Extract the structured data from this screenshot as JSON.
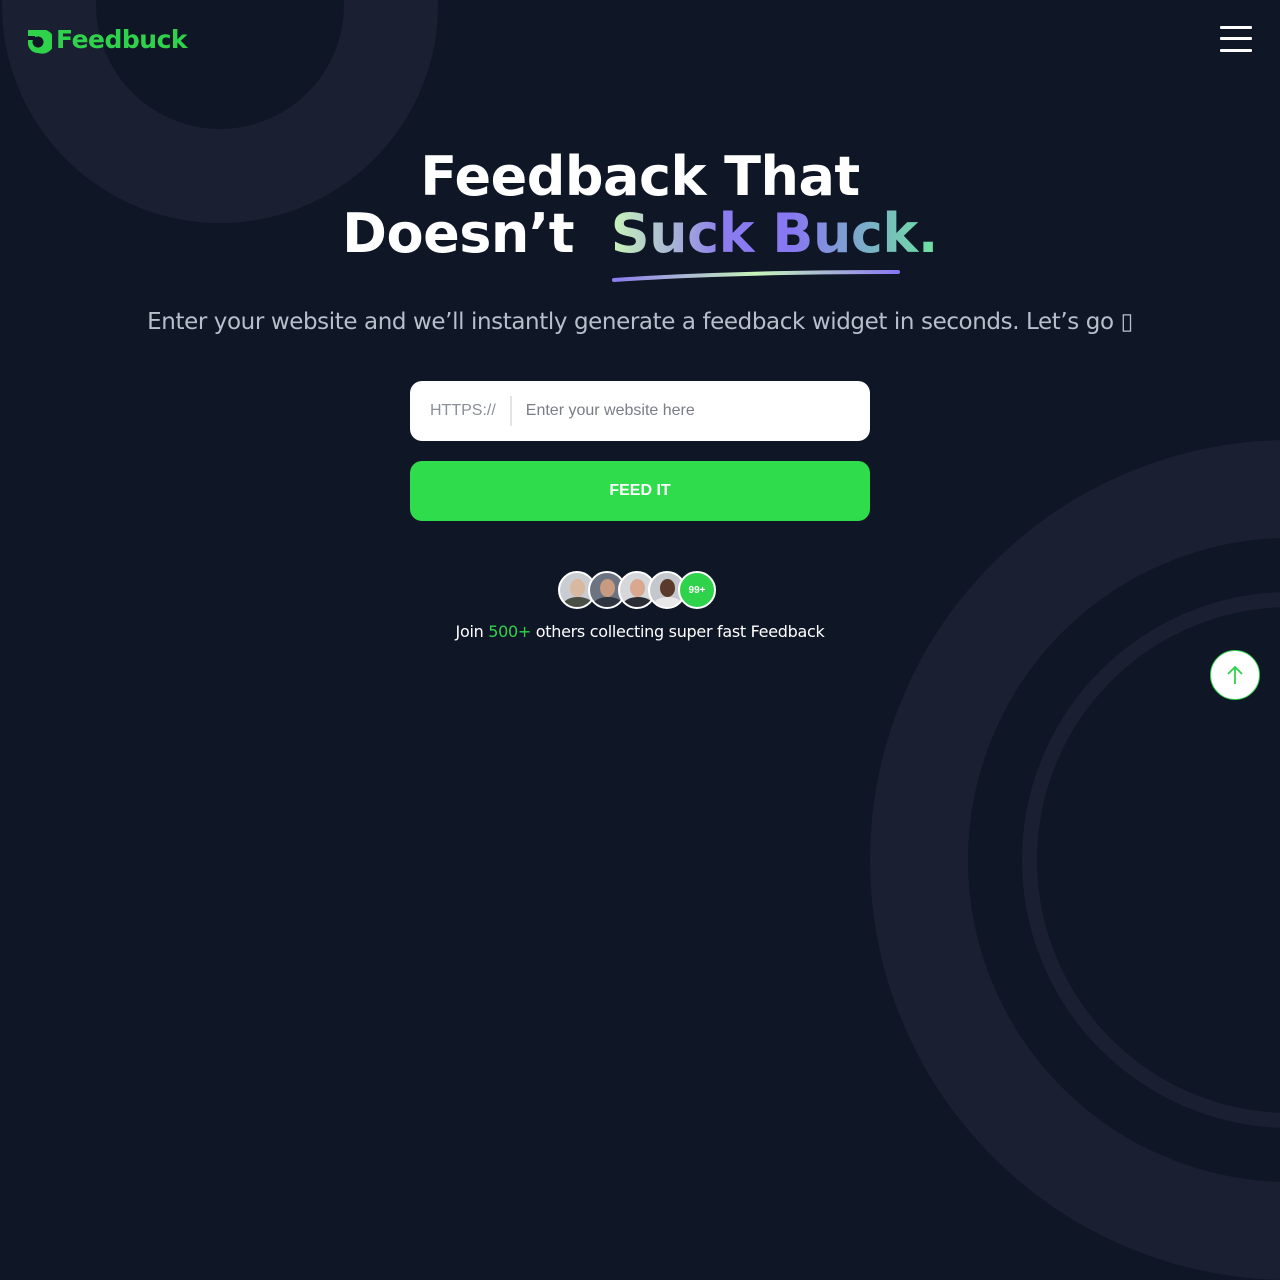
{
  "brand": {
    "name": "Feedbuck",
    "color": "#2fd34b"
  },
  "header": {
    "menu_icon": "hamburger-menu-icon"
  },
  "hero": {
    "title_line1": "Feedback That",
    "title_line2_plain": "Doesn’t",
    "title_line2_highlight": "Suck Buck.",
    "subtitle": "Enter your website and we’ll instantly generate a feedback widget in seconds. Let’s go ▯"
  },
  "form": {
    "prefix": "HTTPS://",
    "placeholder": "Enter your website here",
    "value": "",
    "submit_label": "FEED IT"
  },
  "social_proof": {
    "avatar_count_badge": "99+",
    "join_prefix": "Join",
    "join_count": "500+",
    "join_suffix": "others collecting super fast Feedback"
  },
  "scroll_top": {
    "icon": "arrow-up-icon"
  }
}
